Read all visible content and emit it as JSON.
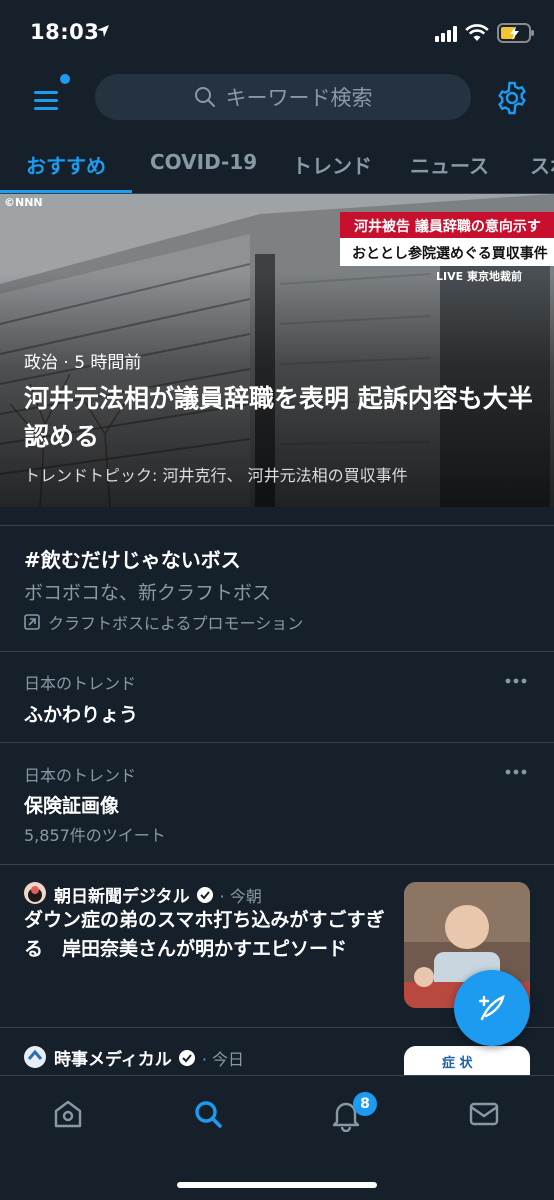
{
  "status_bar": {
    "time": "18:03"
  },
  "header": {
    "search_placeholder": "キーワード検索"
  },
  "tabs": [
    {
      "label": "おすすめ",
      "active": true
    },
    {
      "label": "COVID-19",
      "active": false
    },
    {
      "label": "トレンド",
      "active": false
    },
    {
      "label": "ニュース",
      "active": false
    },
    {
      "label": "スポ",
      "active": false
    }
  ],
  "hero": {
    "watermark": "©NNN",
    "tv_caption_line1": "河井被告 議員辞職の意向示す",
    "tv_caption_line2": "おととし参院選めぐる買収事件",
    "tv_caption_live": "LIVE 東京地裁前",
    "meta": "政治 · 5 時間前",
    "title": "河井元法相が議員辞職を表明 起訴内容も大半認める",
    "topic": "トレンドトピック: 河井克行、 河井元法相の買収事件"
  },
  "promoted": {
    "hashtag": "#飲むだけじゃないボス",
    "description": "ボコボコな、新クラフトボス",
    "promoted_by": "クラフトボスによるプロモーション"
  },
  "trends": [
    {
      "label": "日本のトレンド",
      "name": "ふかわりょう",
      "count": ""
    },
    {
      "label": "日本のトレンド",
      "name": "保険証画像",
      "count": "5,857件のツイート"
    }
  ],
  "news": [
    {
      "source": "朝日新聞デジタル",
      "time": "· 今朝",
      "title": "ダウン症の弟のスマホ打ち込みがすごすぎる　岸田奈美さんが明かすエピソード"
    },
    {
      "source": "時事メディカル",
      "time": "· 今日",
      "title": "",
      "thumb_text": "症 状"
    }
  ],
  "bottom_nav": {
    "notifications_badge": "8"
  },
  "colors": {
    "background": "#15202b",
    "accent": "#1d9bf0",
    "muted": "#8899a6",
    "divider": "#38444d"
  }
}
